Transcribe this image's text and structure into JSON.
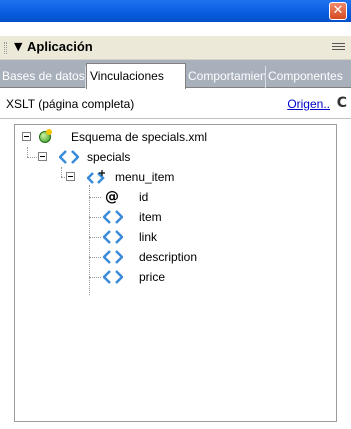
{
  "window": {
    "close_symbol": "✕"
  },
  "panel": {
    "collapse_symbol": "▼",
    "title": "Aplicación"
  },
  "tabs": [
    {
      "label": "Bases de datos",
      "active": false
    },
    {
      "label": "Vinculaciones",
      "active": true
    },
    {
      "label": "Comportamientos",
      "active": false
    },
    {
      "label": "Componentes",
      "active": false
    }
  ],
  "infobar": {
    "document_type": "XSLT (página completa)",
    "source_link": "Origen..",
    "refresh_symbol": "C"
  },
  "tree": {
    "root": {
      "label": "Esquema de specials.xml",
      "icon": "xml-schema-icon"
    },
    "specials": {
      "label": "specials",
      "icon": "element-icon"
    },
    "menu_item": {
      "label": "menu_item",
      "icon": "repeating-element-icon"
    },
    "children": [
      {
        "label": "id",
        "icon": "attribute-icon",
        "symbol": "@"
      },
      {
        "label": "item",
        "icon": "element-icon"
      },
      {
        "label": "link",
        "icon": "element-icon"
      },
      {
        "label": "description",
        "icon": "element-icon"
      },
      {
        "label": "price",
        "icon": "element-icon"
      }
    ]
  },
  "colors": {
    "titlebar": "#0a5ee0",
    "panel_header": "#ece9d8",
    "tab_strip": "#a8b0bc",
    "link": "#0000cc",
    "element_icon": "#3a8bd8"
  }
}
